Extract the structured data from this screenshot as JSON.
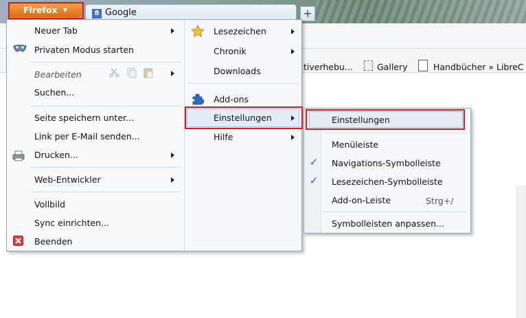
{
  "firefox_button": {
    "label": "Firefox",
    "arrow": "▼"
  },
  "tab": {
    "label": "Google",
    "favicon_letter": "8"
  },
  "new_tab": {
    "label": "+"
  },
  "bookmarks_bar": {
    "item1": "tiverhebu...",
    "item2": "Gallery",
    "item3": "Handbücher » LibreC"
  },
  "main_menu": {
    "left": [
      {
        "label": "Neuer Tab",
        "submenu": true
      },
      {
        "label": "Privaten Modus starten",
        "icon": "private-mask-icon"
      },
      {
        "label": "Bearbeiten",
        "submenu": true,
        "disabled": true
      },
      {
        "label": "Suchen..."
      },
      {
        "label": "Seite speichern unter..."
      },
      {
        "label": "Link per E-Mail senden..."
      },
      {
        "label": "Drucken...",
        "submenu": true,
        "icon": "printer-icon"
      },
      {
        "label": "Web-Entwickler",
        "submenu": true
      },
      {
        "label": "Vollbild"
      },
      {
        "label": "Sync einrichten..."
      },
      {
        "label": "Beenden",
        "icon": "close-red-icon"
      }
    ],
    "right": [
      {
        "label": "Lesezeichen",
        "submenu": true,
        "icon": "star-icon"
      },
      {
        "label": "Chronik",
        "submenu": true
      },
      {
        "label": "Downloads"
      },
      {
        "label": "Add-ons",
        "icon": "puzzle-icon"
      },
      {
        "label": "Einstellungen",
        "submenu": true,
        "highlighted": true
      },
      {
        "label": "Hilfe",
        "submenu": true
      }
    ]
  },
  "sub_menu": [
    {
      "label": "Einstellungen",
      "highlighted": true
    },
    {
      "label": "Menüleiste",
      "checked": false
    },
    {
      "label": "Navigations-Symbolleiste",
      "checked": true
    },
    {
      "label": "Lesezeichen-Symbolleiste",
      "checked": true
    },
    {
      "label": "Add-on-Leiste",
      "shortcut": "Strg+/",
      "checked": false
    },
    {
      "label": "Symbolleisten anpassen..."
    }
  ],
  "check_mark": "✓",
  "colors": {
    "firefox_orange": "#e07a20",
    "highlight_red": "#d41c1c",
    "menu_bg": "#f6f8fb",
    "check_blue": "#2a5fb8"
  }
}
